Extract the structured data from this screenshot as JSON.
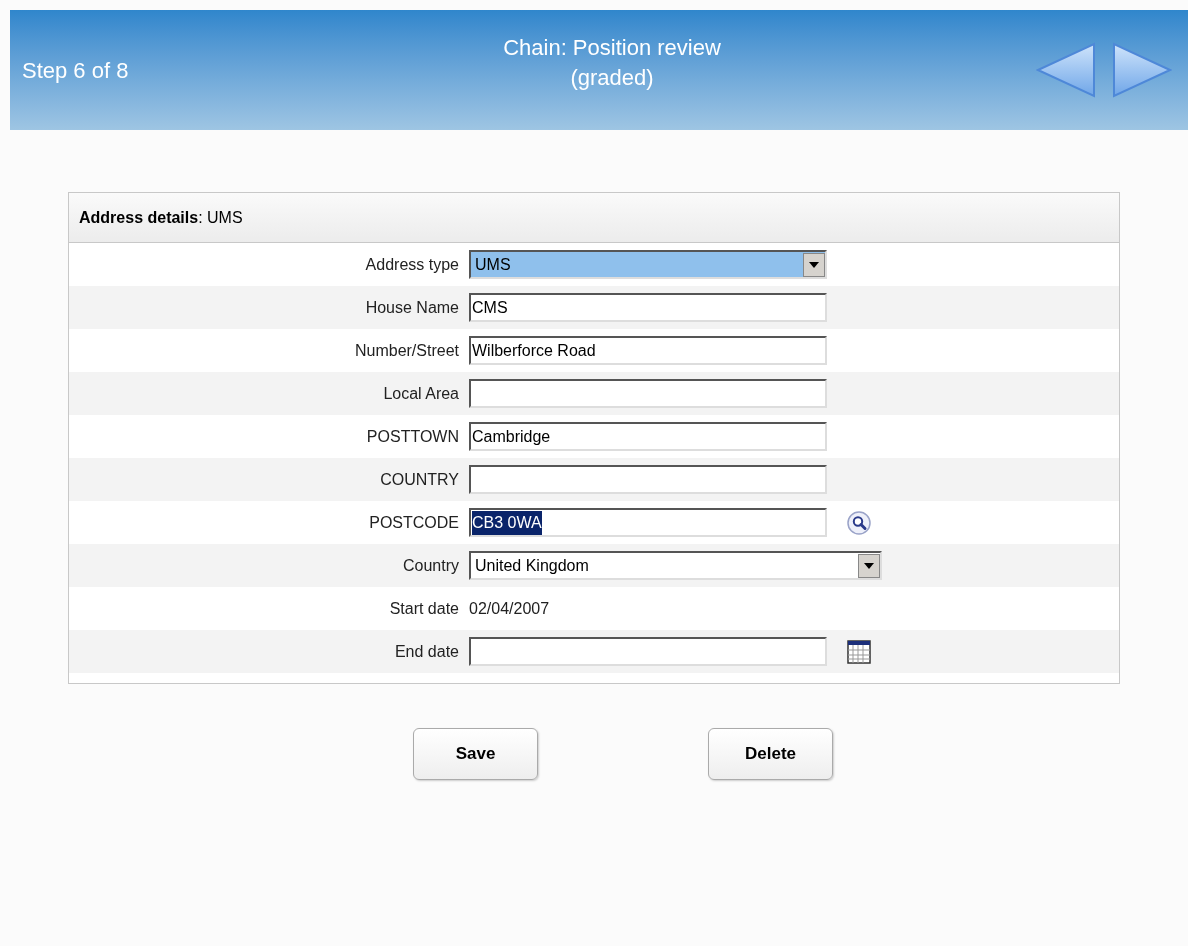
{
  "header": {
    "step": "Step 6 of 8",
    "title_lines": [
      "Chain: Position review",
      "(graded)"
    ]
  },
  "panel": {
    "title": "**Address details**: UMS",
    "fields": [
      {
        "kind": "select",
        "label": "Address type",
        "value": "UMS",
        "highlighted": true,
        "wide": false
      },
      {
        "kind": "text",
        "label": "House Name",
        "value": "CMS",
        "highlighted": false
      },
      {
        "kind": "text",
        "label": "Number/Street",
        "value": "Wilberforce Road",
        "highlighted": false
      },
      {
        "kind": "text",
        "label": "Local Area"
      },
      {
        "kind": "text",
        "label": "POSTTOWN",
        "value": "Cambridge",
        "highlighted": false
      },
      {
        "kind": "text",
        "label": "COUNTRY"
      },
      {
        "kind": "text",
        "label": "POSTCODE",
        "value": "CB3 0WA",
        "highlighted": true,
        "trailing": {
          "kind": "search"
        }
      },
      {
        "kind": "select",
        "label": "Country",
        "value": "United Kingdom",
        "highlighted": false,
        "wide": true
      },
      {
        "kind": "static",
        "label": "Start date",
        "value": "02/04/2007"
      },
      {
        "kind": "text",
        "label": "End date",
        "trailing": {
          "kind": "calendar"
        }
      }
    ]
  },
  "buttons": [
    "Save",
    "Delete"
  ]
}
